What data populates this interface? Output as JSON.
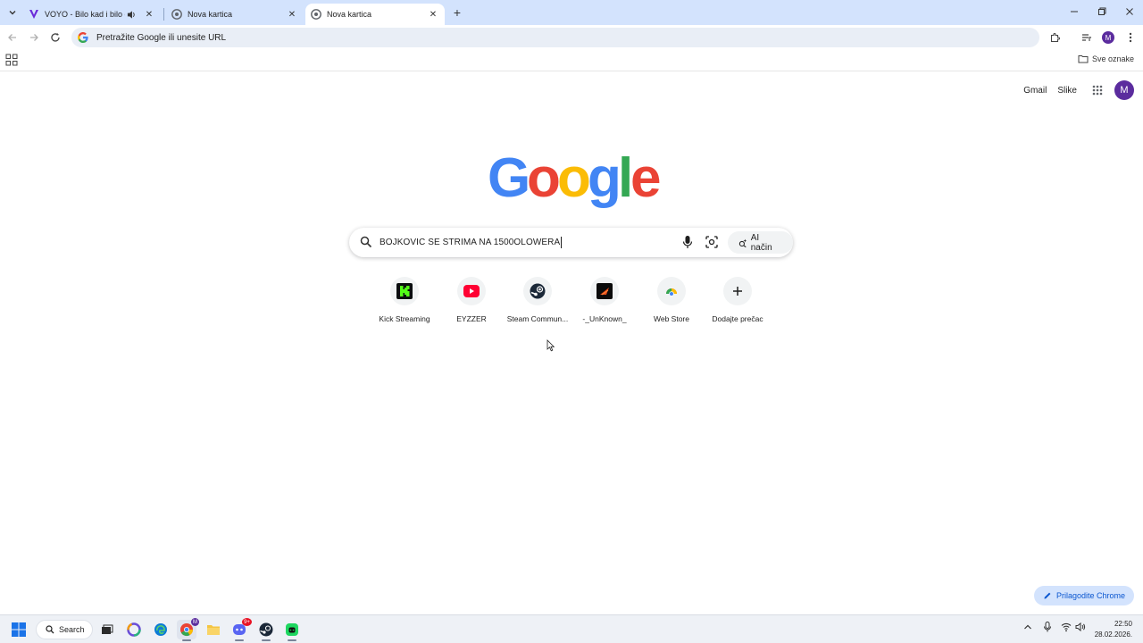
{
  "tabs": [
    {
      "title": "VOYO - Bilo kad i bilo gdje",
      "favicon": "voyo-icon",
      "audio": true,
      "active": false
    },
    {
      "title": "Nova kartica",
      "favicon": "chrome-icon",
      "active": false
    },
    {
      "title": "Nova kartica",
      "favicon": "chrome-icon",
      "active": true
    }
  ],
  "omnibox": {
    "placeholder": "Pretražite Google ili unesite URL"
  },
  "bookmarks": {
    "all_label": "Sve oznake"
  },
  "google_header": {
    "gmail": "Gmail",
    "images": "Slike",
    "avatar_letter": "M"
  },
  "profile_letter": "M",
  "search": {
    "query": "BOJKOVIC SE STRIMA NA 1500OLOWERA",
    "ai_mode_label": "AI način"
  },
  "shortcuts": [
    {
      "label": "Kick Streaming",
      "icon": "kick-icon"
    },
    {
      "label": "EYZZER",
      "icon": "youtube-icon"
    },
    {
      "label": "Steam Commun...",
      "icon": "steam-icon"
    },
    {
      "label": "-_UnKnown_",
      "icon": "unknown-icon"
    },
    {
      "label": "Web Store",
      "icon": "webstore-icon"
    },
    {
      "label": "Dodajte prečac",
      "icon": "plus-icon"
    }
  ],
  "customize": {
    "label": "Prilagodite Chrome"
  },
  "taskbar": {
    "search_label": "Search",
    "time": "22:50",
    "date": "28.02.2026.",
    "discord_badge": "9+"
  },
  "colors": {
    "tabstrip": "#d3e3fd",
    "omnibox": "#e9eef6",
    "avatar": "#5b2c9e",
    "accent": "#0b57d0"
  }
}
